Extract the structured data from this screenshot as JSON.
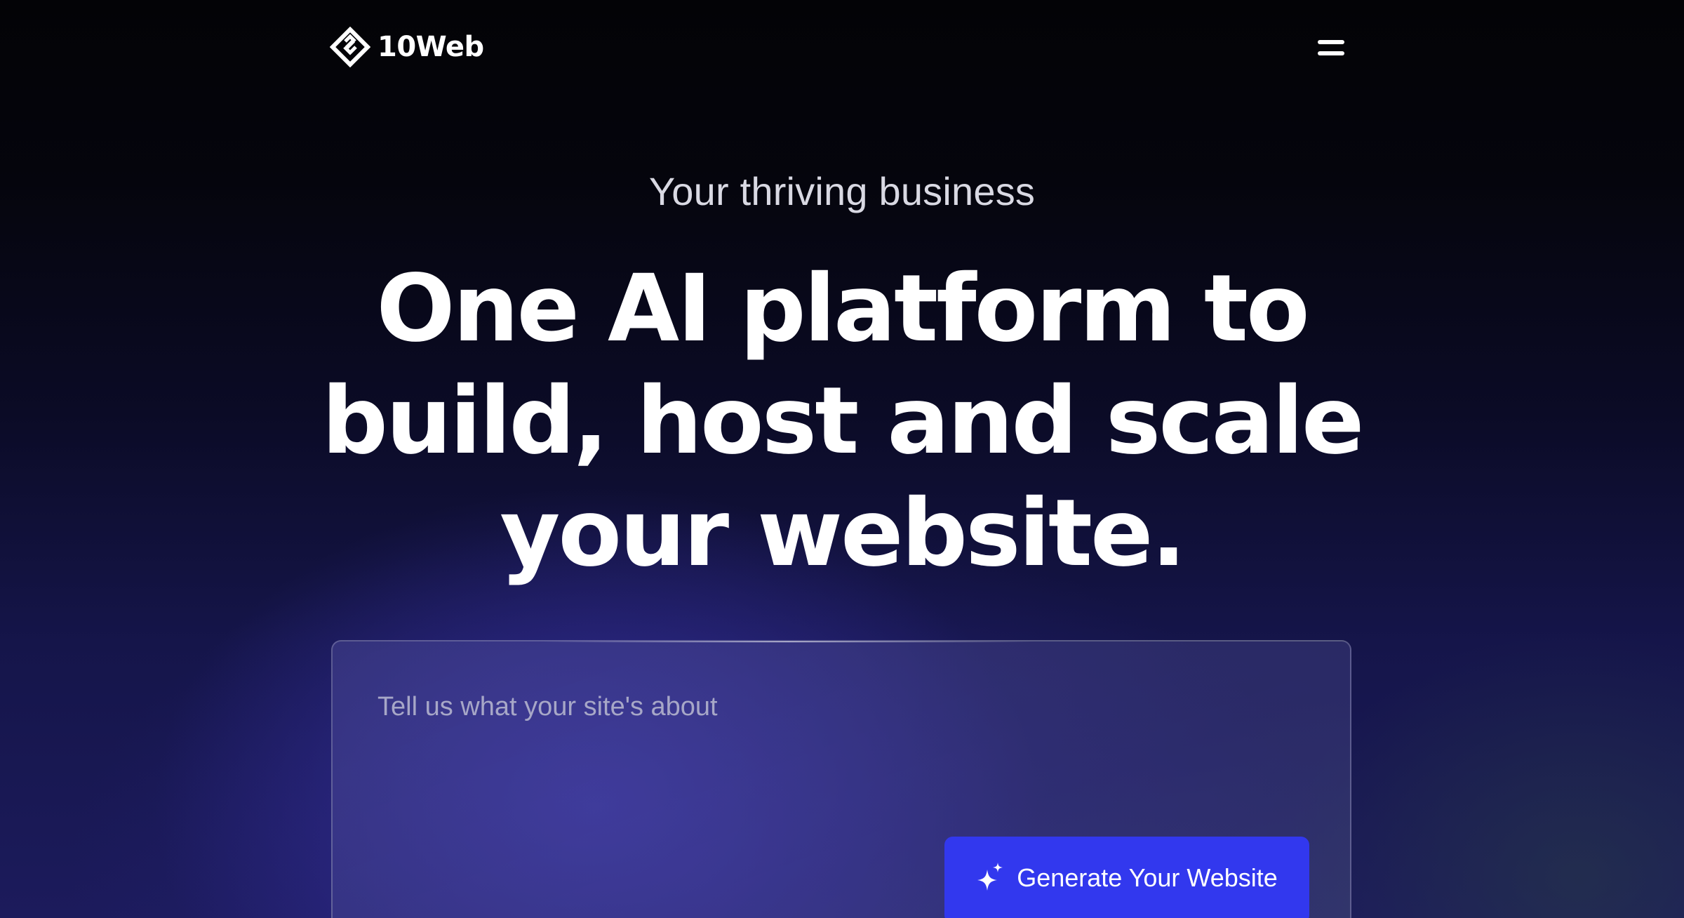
{
  "header": {
    "brand_name": "10Web",
    "logo_icon": "10web-diamond-logo-icon",
    "menu_icon": "hamburger-menu-icon"
  },
  "hero": {
    "eyebrow": "Your thriving business",
    "headline_lines": [
      "One AI platform to",
      "build, host and scale",
      "your website."
    ]
  },
  "prompt": {
    "placeholder": "Tell us what your site's about",
    "value": "",
    "generate_label": "Generate Your Website",
    "generate_icon": "sparkle-icon",
    "button_color": "#3238ee"
  }
}
